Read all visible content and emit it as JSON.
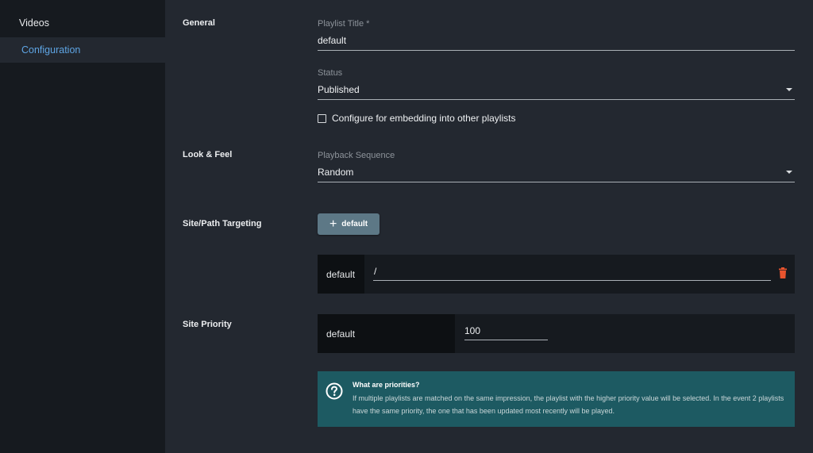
{
  "sidebar": {
    "items": [
      {
        "label": "Videos"
      },
      {
        "label": "Configuration"
      }
    ]
  },
  "sections": {
    "general": "General",
    "look_feel": "Look & Feel",
    "targeting": "Site/Path Targeting",
    "priority": "Site Priority"
  },
  "fields": {
    "playlist_title": {
      "label": "Playlist Title *",
      "value": "default"
    },
    "status": {
      "label": "Status",
      "value": "Published"
    },
    "embedding": {
      "label": "Configure for embedding into other playlists",
      "checked": false
    },
    "playback_sequence": {
      "label": "Playback Sequence",
      "value": "Random"
    }
  },
  "targeting": {
    "add_button_label": "default",
    "rows": [
      {
        "site": "default",
        "path": "/"
      }
    ]
  },
  "priority": {
    "rows": [
      {
        "site": "default",
        "value": "100"
      }
    ]
  },
  "info": {
    "title": "What are priorities?",
    "text": "If multiple playlists are matched on the same impression, the playlist with the higher priority value will be selected. In the event 2 playlists have the same priority, the one that has been updated most recently will be played."
  },
  "colors": {
    "accent": "#5ea5e4",
    "button": "#5d7886",
    "danger": "#e8542e",
    "info_bg": "#1d5a62"
  }
}
